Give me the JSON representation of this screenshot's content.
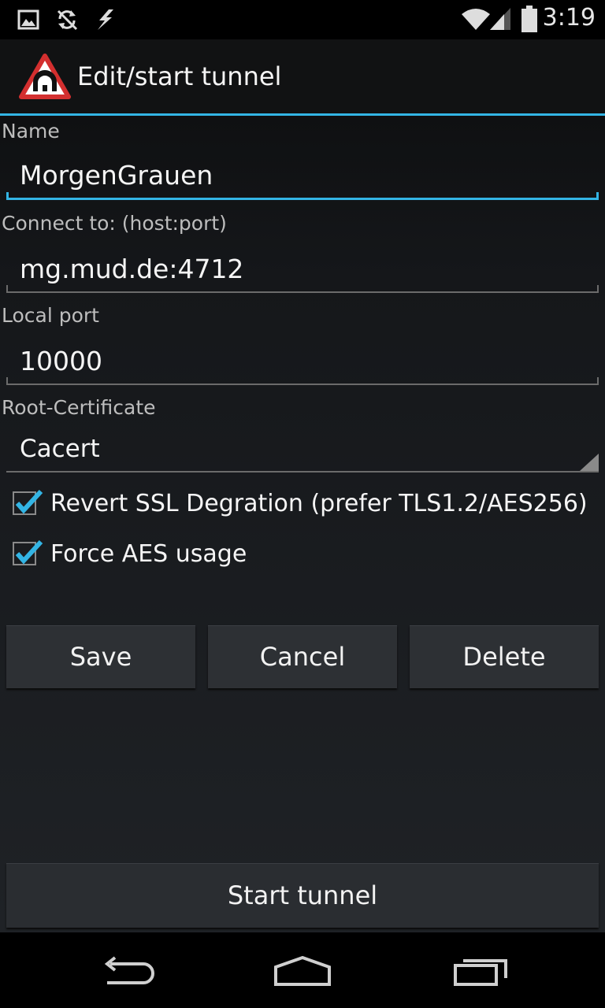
{
  "status_bar": {
    "time": "3:19",
    "left_icons": [
      "image-icon",
      "sync-off-icon",
      "lightning-icon"
    ],
    "right_icons": [
      "wifi-icon",
      "cell-signal-icon",
      "battery-icon"
    ]
  },
  "action_bar": {
    "title": "Edit/start tunnel",
    "icon": "tunnel-warning-icon",
    "accent_color": "#33b5e5",
    "icon_color": "#d32f2f"
  },
  "form": {
    "name_label": "Name",
    "name_value": "MorgenGrauen",
    "connect_label": "Connect to: (host:port)",
    "connect_value": "mg.mud.de:4712",
    "local_port_label": "Local port",
    "local_port_value": "10000",
    "root_cert_label": "Root-Certificate",
    "root_cert_value": "Cacert",
    "revert_ssl_label": "Revert SSL Degration (prefer TLS1.2/AES256)",
    "revert_ssl_checked": true,
    "force_aes_label": "Force AES usage",
    "force_aes_checked": true
  },
  "buttons": {
    "save": "Save",
    "cancel": "Cancel",
    "delete": "Delete",
    "start_tunnel": "Start tunnel"
  },
  "nav_bar": {
    "icons": [
      "back-icon",
      "home-icon",
      "recent-apps-icon"
    ]
  }
}
